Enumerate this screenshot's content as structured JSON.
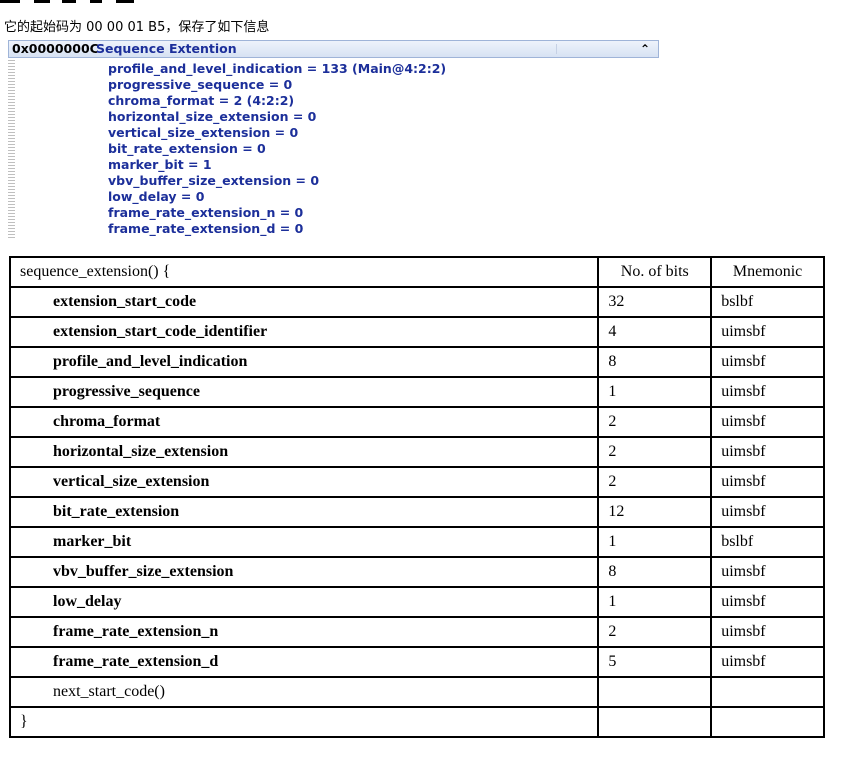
{
  "intro_text": "它的起始码为 00 00 01 B5，保存了如下信息",
  "panel": {
    "offset": "0x0000000C",
    "title": "Sequence Extention",
    "collapse_icon": "double-chevron-up-icon",
    "fields": [
      "profile_and_level_indication = 133 (Main@4:2:2)",
      "progressive_sequence  = 0",
      "chroma_format = 2 (4:2:2)",
      "horizontal_size_extension = 0",
      "vertical_size_extension = 0",
      "bit_rate_extension = 0",
      "marker_bit = 1",
      "vbv_buffer_size_extension = 0",
      "low_delay = 0",
      "frame_rate_extension_n = 0",
      "frame_rate_extension_d = 0"
    ]
  },
  "syntax_table": {
    "header": {
      "func": "sequence_extension() {",
      "bits": "No. of bits",
      "mnemonic": "Mnemonic"
    },
    "rows": [
      {
        "name": "extension_start_code",
        "bits": "32",
        "mnemonic": "bslbf"
      },
      {
        "name": "extension_start_code_identifier",
        "bits": "4",
        "mnemonic": "uimsbf"
      },
      {
        "name": "profile_and_level_indication",
        "bits": "8",
        "mnemonic": "uimsbf"
      },
      {
        "name": "progressive_sequence",
        "bits": "1",
        "mnemonic": "uimsbf"
      },
      {
        "name": "chroma_format",
        "bits": "2",
        "mnemonic": "uimsbf"
      },
      {
        "name": "horizontal_size_extension",
        "bits": "2",
        "mnemonic": "uimsbf"
      },
      {
        "name": "vertical_size_extension",
        "bits": "2",
        "mnemonic": "uimsbf"
      },
      {
        "name": "bit_rate_extension",
        "bits": "12",
        "mnemonic": "uimsbf"
      },
      {
        "name": "marker_bit",
        "bits": "1",
        "mnemonic": "bslbf"
      },
      {
        "name": "vbv_buffer_size_extension",
        "bits": "8",
        "mnemonic": "uimsbf"
      },
      {
        "name": "low_delay",
        "bits": "1",
        "mnemonic": "uimsbf"
      },
      {
        "name": "frame_rate_extension_n",
        "bits": "2",
        "mnemonic": "uimsbf"
      },
      {
        "name": "frame_rate_extension_d",
        "bits": "5",
        "mnemonic": "uimsbf"
      }
    ],
    "next_start_code": "next_start_code()",
    "closing_brace": "}"
  }
}
